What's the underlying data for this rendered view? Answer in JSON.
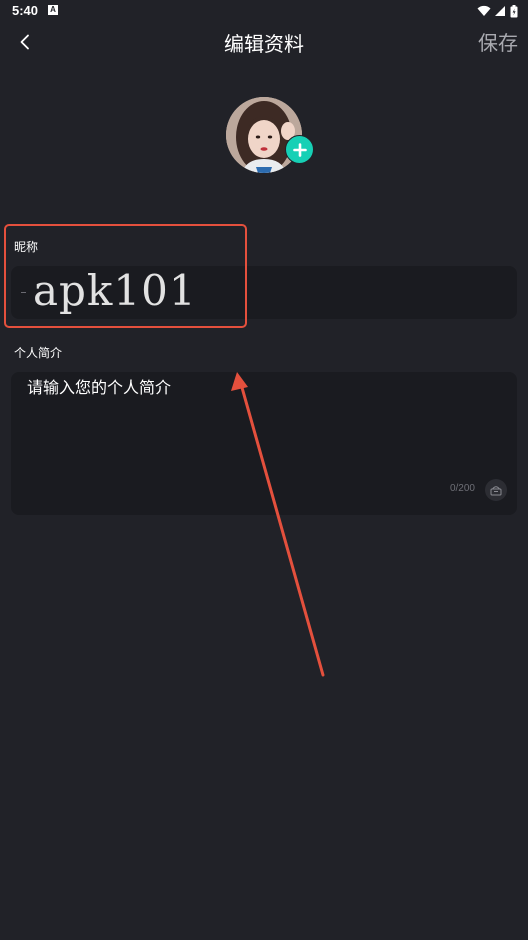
{
  "status_bar": {
    "time": "5:40",
    "notification_icon": "A",
    "icons": [
      "wifi-icon",
      "signal-icon",
      "battery-icon"
    ]
  },
  "header": {
    "back_icon": "chevron-left-icon",
    "title": "编辑资料",
    "save_label": "保存"
  },
  "profile": {
    "avatar_icon": "user-avatar",
    "add_icon": "plus-icon"
  },
  "nickname": {
    "label": "昵称",
    "value": "apk101"
  },
  "bio": {
    "label": "个人简介",
    "placeholder": "请输入您的个人简介",
    "counter": "0/200",
    "emoji_icon": "emoji-icon"
  },
  "annotation": {
    "color": "#e4503d"
  },
  "colors": {
    "background": "#212228",
    "field_background": "#1a1b20",
    "accent": "#16d0b5"
  }
}
